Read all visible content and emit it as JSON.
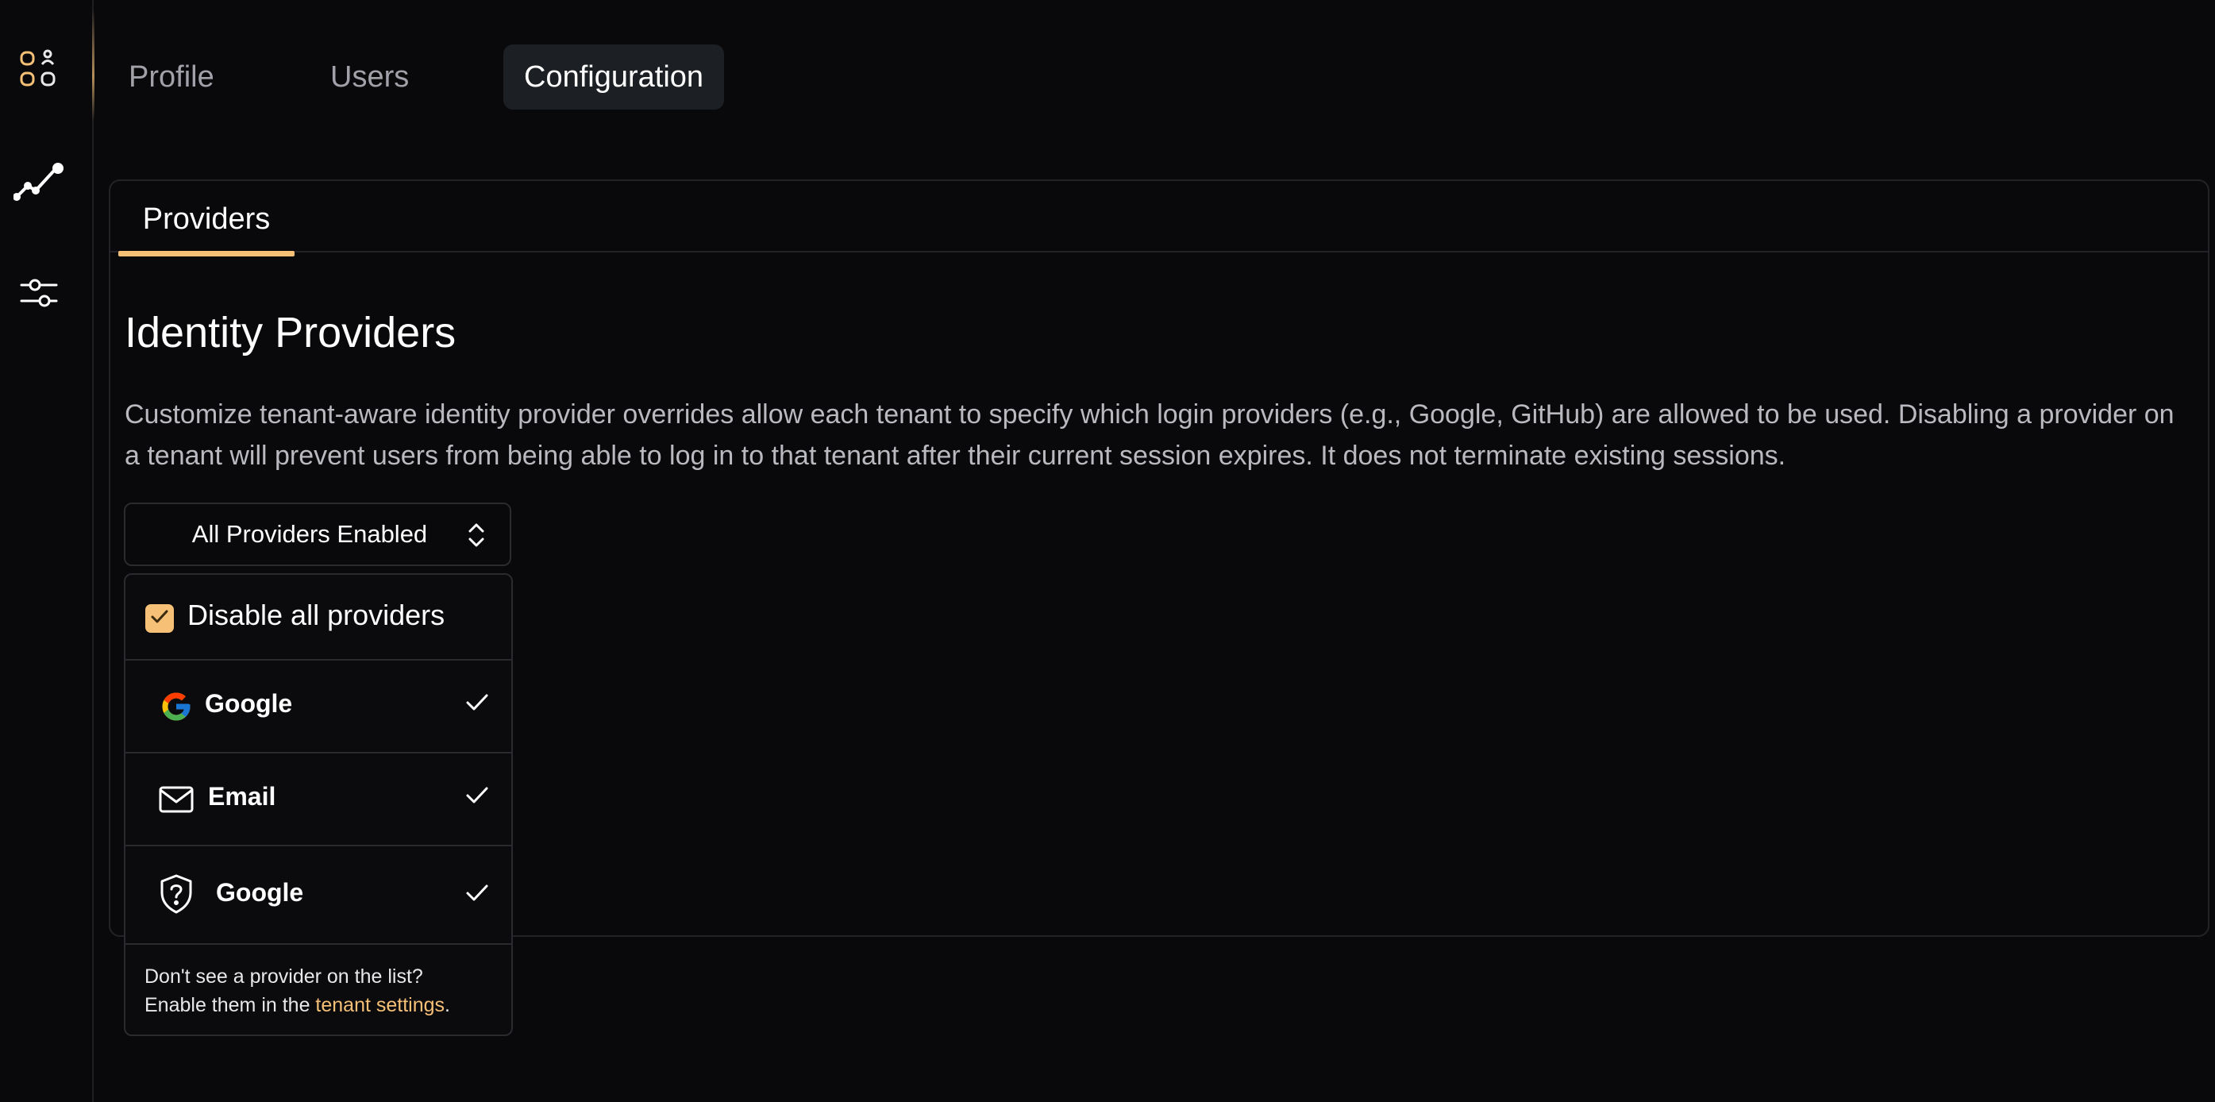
{
  "rail": {
    "items": [
      {
        "icon": "apps-users-icon"
      },
      {
        "icon": "analytics-icon"
      },
      {
        "icon": "sliders-icon"
      }
    ]
  },
  "top_tabs": [
    {
      "label": "Profile",
      "active": false
    },
    {
      "label": "Users",
      "active": false
    },
    {
      "label": "Configuration",
      "active": true
    }
  ],
  "card": {
    "tab_label": "Providers",
    "title": "Identity Providers",
    "description": "Customize tenant-aware identity provider overrides allow each tenant to specify which login providers (e.g., Google, GitHub) are allowed to be used. Disabling a provider on a tenant will prevent users from being able to log in to that tenant after their current session expires. It does not terminate existing sessions."
  },
  "select": {
    "value": "All Providers Enabled"
  },
  "dropdown": {
    "disable_all_label": "Disable all providers",
    "disable_all_checked": true,
    "providers": [
      {
        "label": "Google",
        "icon": "google-icon",
        "checked": true
      },
      {
        "label": "Email",
        "icon": "mail-icon",
        "checked": true
      },
      {
        "label": "Google",
        "icon": "shield-question-icon",
        "checked": true
      }
    ],
    "footer_line1": "Don't see a provider on the list?",
    "footer_line2_prefix": "Enable them in the ",
    "footer_link": "tenant settings",
    "footer_suffix": "."
  },
  "colors": {
    "accent": "#f6c177",
    "background": "#09090b",
    "border": "#2a2a2f"
  }
}
